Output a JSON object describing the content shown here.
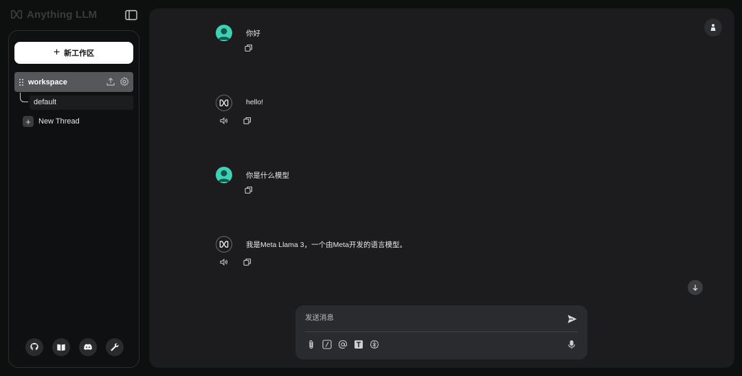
{
  "app": {
    "title": "Anything LLM"
  },
  "sidebar": {
    "new_workspace_label": "新工作区",
    "workspace": {
      "name": "workspace",
      "threads": [
        {
          "label": "default"
        }
      ],
      "new_thread_label": "New Thread"
    },
    "footer_icons": [
      "github-icon",
      "docs-book-icon",
      "discord-icon",
      "settings-wrench-icon"
    ]
  },
  "chat": {
    "messages": [
      {
        "role": "user",
        "text": "你好"
      },
      {
        "role": "assistant",
        "text": "hello!"
      },
      {
        "role": "user",
        "text": "你是什么模型"
      },
      {
        "role": "assistant",
        "text": "我是Meta Llama 3，一个由Meta开发的语言模型。"
      }
    ]
  },
  "composer": {
    "placeholder": "发送消息",
    "tools": [
      "attach-icon",
      "slash-command-icon",
      "at-mention-icon",
      "text-size-icon",
      "agent-brain-icon"
    ]
  },
  "colors": {
    "accent_user_avatar": "#3ed1b5",
    "panel_bg": "#1c1c1e",
    "page_bg": "#0e0f0f",
    "workspace_active_bg": "#55575b"
  }
}
